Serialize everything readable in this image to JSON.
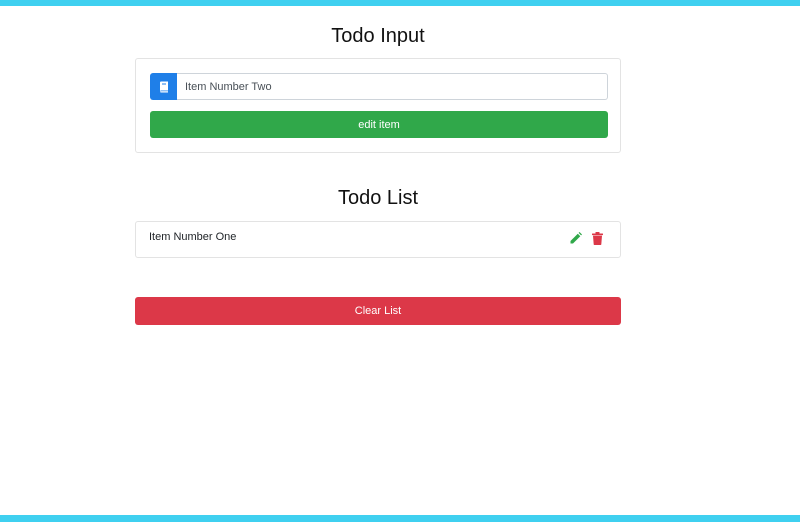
{
  "input_section": {
    "title": "Todo Input",
    "prefix_icon": "book-icon",
    "input_value": "Item Number Two",
    "submit_label": "edit item",
    "colors": {
      "prefix": "#1f7fe8",
      "submit": "#30a84a"
    }
  },
  "list_section": {
    "title": "Todo List",
    "items": [
      {
        "text": "Item Number One",
        "edit_icon": "pencil-icon",
        "delete_icon": "trash-icon"
      }
    ],
    "clear_label": "Clear List",
    "colors": {
      "edit": "#30a84a",
      "delete": "#dc3848",
      "clear": "#dc3848"
    }
  },
  "page": {
    "accent": "#3fd0f0"
  }
}
